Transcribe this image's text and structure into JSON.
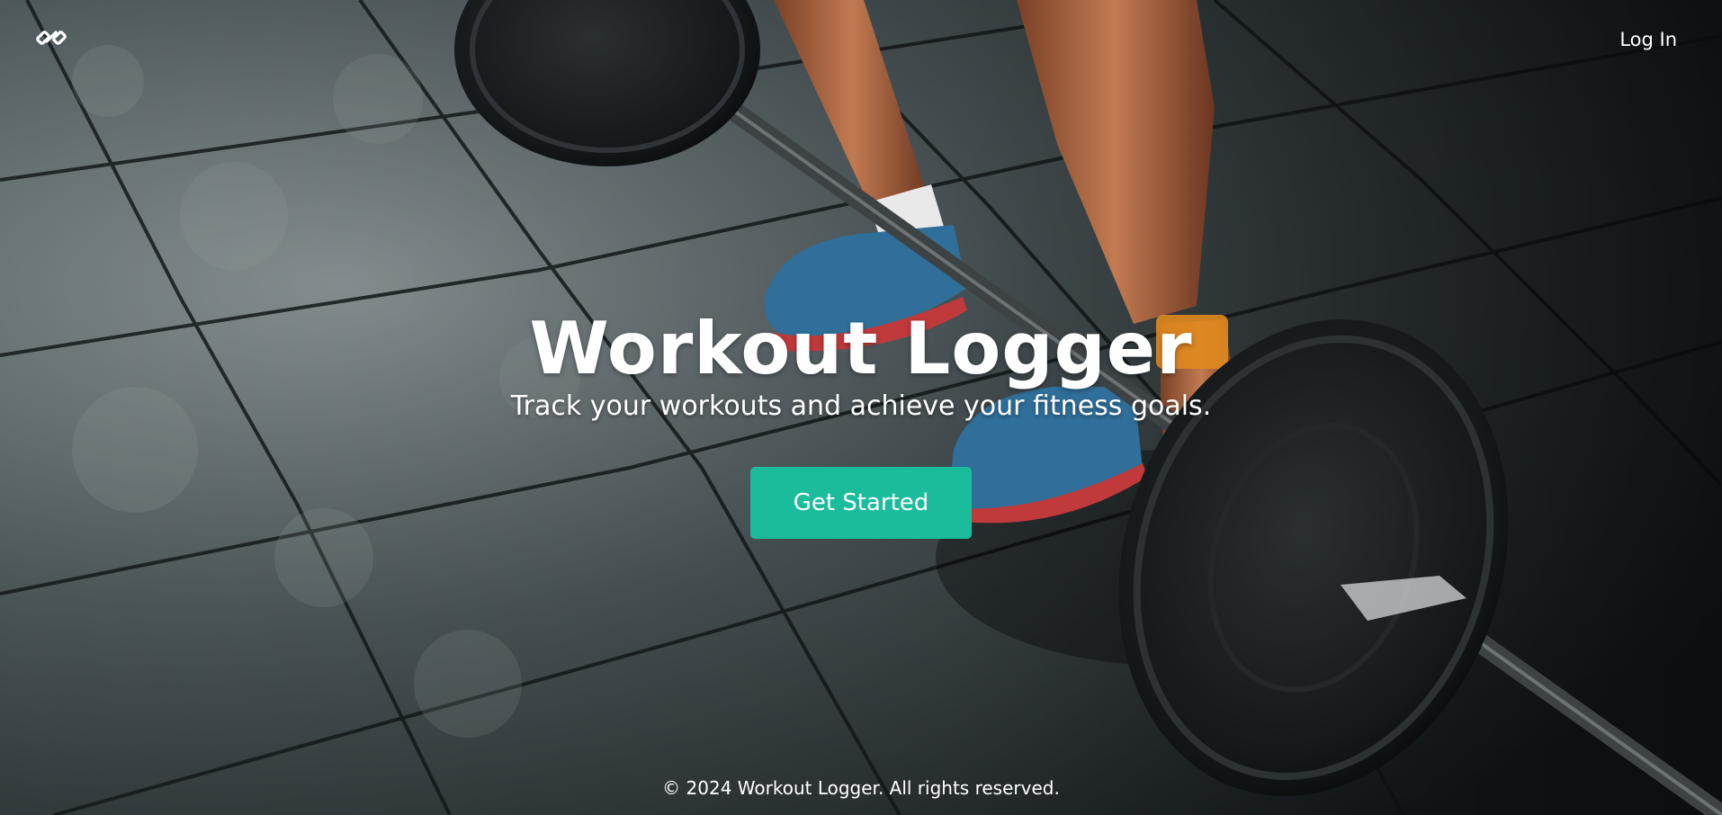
{
  "header": {
    "logo_icon": "dumbbell-icon",
    "login_label": "Log In"
  },
  "hero": {
    "title": "Workout Logger",
    "subtitle": "Track your workouts and achieve your fitness goals.",
    "cta_label": "Get Started",
    "background": "gym-floor-barbell-photo"
  },
  "footer": {
    "copyright": "© 2024 Workout Logger. All rights reserved."
  },
  "colors": {
    "accent": "#1abc9c",
    "text": "#ffffff",
    "floor_dark": "#1f2628",
    "floor_light": "#5a6668",
    "shoe_blue": "#2f6f9a"
  }
}
